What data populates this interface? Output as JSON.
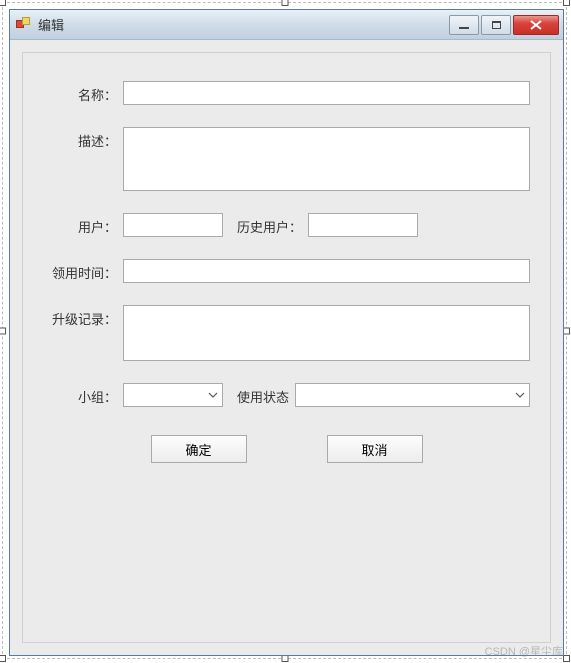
{
  "window": {
    "title": "编辑"
  },
  "form": {
    "name_label": "名称：",
    "name_value": "",
    "desc_label": "描述：",
    "desc_value": "",
    "user_label": "用户：",
    "user_value": "",
    "history_user_label": "历史用户：",
    "history_user_value": "",
    "checkout_time_label": "领用时间：",
    "checkout_time_value": "",
    "upgrade_log_label": "升级记录：",
    "upgrade_log_value": "",
    "group_label": "小组：",
    "group_value": "",
    "status_label": "使用状态",
    "status_value": ""
  },
  "buttons": {
    "ok": "确定",
    "cancel": "取消"
  },
  "watermark": "CSDN @星尘库"
}
